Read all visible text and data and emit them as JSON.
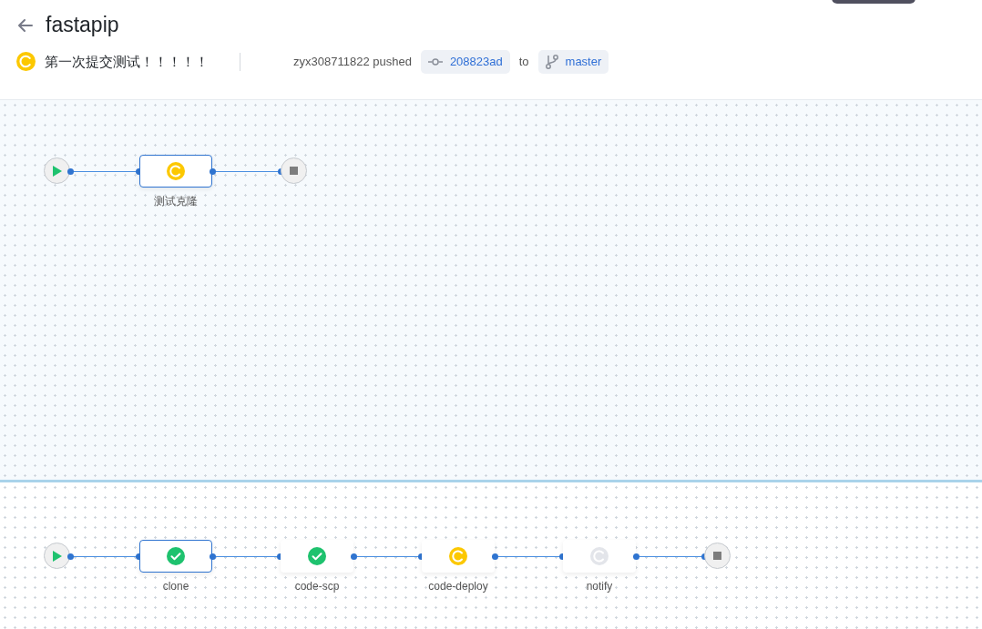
{
  "header": {
    "title": "fastapip",
    "kind": "running",
    "message": "第一次提交测试！！！！！",
    "pusher": "zyx308711822 pushed",
    "commit": "208823ad",
    "connector_word": "to",
    "branch": "master"
  },
  "pipelines": [
    {
      "jobs": [
        {
          "name": "测试克隆",
          "kind": "running",
          "selected": true
        }
      ]
    },
    {
      "jobs": [
        {
          "name": "clone",
          "kind": "success",
          "selected": true
        },
        {
          "name": "code-scp",
          "kind": "success",
          "selected": false
        },
        {
          "name": "code-deploy",
          "kind": "running",
          "selected": false
        },
        {
          "name": "notify",
          "kind": "pending",
          "selected": false
        }
      ]
    }
  ]
}
